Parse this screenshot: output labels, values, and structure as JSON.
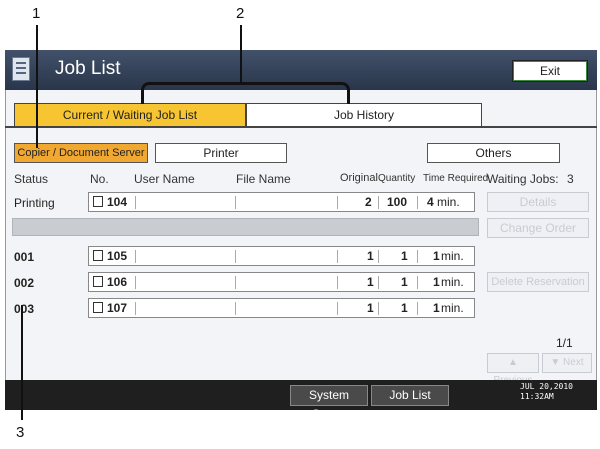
{
  "callouts": {
    "c1": "1",
    "c2": "2",
    "c3": "3"
  },
  "header": {
    "title": "Job List",
    "exit_label": "Exit",
    "icon": "job-list-icon"
  },
  "tabs": [
    {
      "label": "Current / Waiting Job List",
      "active": true
    },
    {
      "label": "Job History",
      "active": false
    }
  ],
  "filters": {
    "copier": "Copier / Document Server",
    "printer": "Printer",
    "others": "Others"
  },
  "columns": {
    "status": "Status",
    "no": "No.",
    "user": "User Name",
    "file": "File Name",
    "original": "Original",
    "quantity": "Quantity",
    "time": "Time Required"
  },
  "waiting": {
    "label": "Waiting Jobs:",
    "count": "3"
  },
  "printing": {
    "status": "Printing",
    "no": "104",
    "original": "2",
    "quantity": "100",
    "time_num": "4",
    "time_unit": "min."
  },
  "queue": [
    {
      "status": "001",
      "no": "105",
      "original": "1",
      "quantity": "1",
      "time_num": "1",
      "time_unit": "min."
    },
    {
      "status": "002",
      "no": "106",
      "original": "1",
      "quantity": "1",
      "time_num": "1",
      "time_unit": "min."
    },
    {
      "status": "003",
      "no": "107",
      "original": "1",
      "quantity": "1",
      "time_num": "1",
      "time_unit": "min."
    }
  ],
  "actions": {
    "details": "Details",
    "change_order": "Change Order",
    "delete_reservation": "Delete Reservation"
  },
  "pager": {
    "page": "1/1",
    "previous": "▲ Previous",
    "next": "▼ Next"
  },
  "statusbar": {
    "system_status": "System Status",
    "job_list": "Job List",
    "date": "JUL  20,2010",
    "time": "11:32AM"
  },
  "colors": {
    "accent": "#f7c531",
    "selected": "#f0a830",
    "titlebar": "#29354a"
  }
}
